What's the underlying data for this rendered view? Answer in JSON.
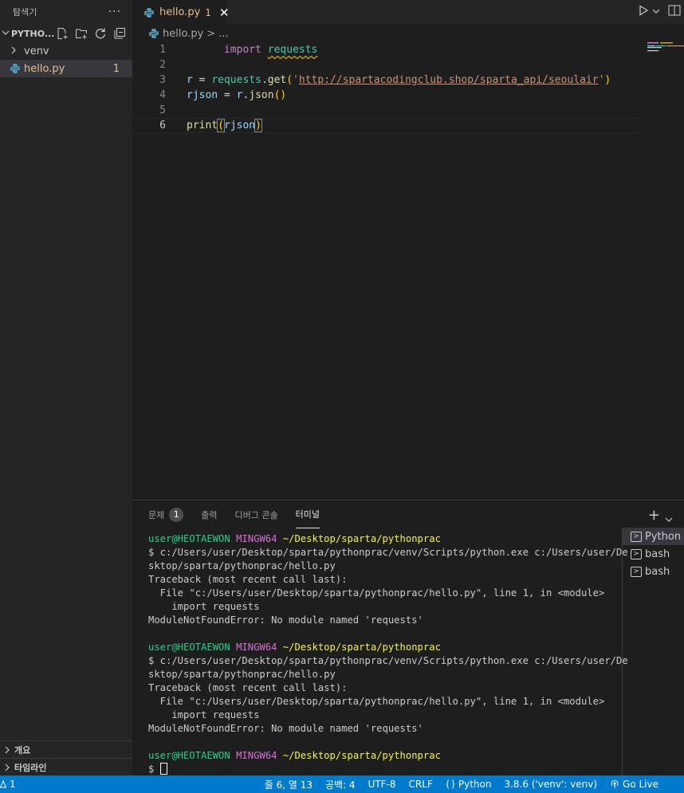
{
  "sidebar": {
    "title": "탐색기",
    "more": "···",
    "project": "PYTHO...",
    "tree": [
      {
        "label": "venv",
        "type": "folder"
      },
      {
        "label": "hello.py",
        "type": "file",
        "badge": "1"
      }
    ],
    "sections": [
      "개요",
      "타임라인"
    ]
  },
  "tab": {
    "label": "hello.py",
    "badge": "1",
    "close": "✕"
  },
  "breadcrumb": {
    "file": "hello.py",
    "sep": ">",
    "more": "..."
  },
  "editor": {
    "line_numbers": [
      "1",
      "2",
      "3",
      "4",
      "5",
      "6"
    ],
    "tokens": {
      "l1_kw": "import",
      "l1_mod": "requests",
      "l3_r": "r",
      "l3_eq": " = ",
      "l3_mod": "requests",
      "l3_dot": ".",
      "l3_fn": "get",
      "l3_open": "(",
      "l3_q1": "'",
      "l3_url": "http://spartacodingclub.shop/sparta_api/seoulair",
      "l3_q2": "'",
      "l3_close": ")",
      "l4_var": "rjson",
      "l4_eq": " = ",
      "l4_r": "r",
      "l4_dot": ".",
      "l4_fn": "json",
      "l4_parens": "()",
      "l6_fn": "print",
      "l6_open": "(",
      "l6_var": "rjson",
      "l6_close": ")"
    }
  },
  "panel": {
    "tabs": [
      {
        "label": "문제",
        "badge": "1"
      },
      {
        "label": "출력"
      },
      {
        "label": "디버그 콘솔"
      },
      {
        "label": "터미널"
      }
    ],
    "add": "+",
    "terminal_blocks": [
      {
        "user": "user@HEOTAEWON",
        "mingw": "MINGW64",
        "path": "~/Desktop/sparta/pythonprac",
        "lines": [
          "$ c:/Users/user/Desktop/sparta/pythonprac/venv/Scripts/python.exe c:/Users/user/De",
          "sktop/sparta/pythonprac/hello.py",
          "Traceback (most recent call last):",
          "  File \"c:/Users/user/Desktop/sparta/pythonprac/hello.py\", line 1, in <module>",
          "    import requests",
          "ModuleNotFoundError: No module named 'requests'"
        ]
      },
      {
        "user": "user@HEOTAEWON",
        "mingw": "MINGW64",
        "path": "~/Desktop/sparta/pythonprac",
        "lines": [
          "$ c:/Users/user/Desktop/sparta/pythonprac/venv/Scripts/python.exe c:/Users/user/De",
          "sktop/sparta/pythonprac/hello.py",
          "Traceback (most recent call last):",
          "  File \"c:/Users/user/Desktop/sparta/pythonprac/hello.py\", line 1, in <module>",
          "    import requests",
          "ModuleNotFoundError: No module named 'requests'"
        ]
      }
    ],
    "prompt_block": {
      "user": "user@HEOTAEWON",
      "mingw": "MINGW64",
      "path": "~/Desktop/sparta/pythonprac",
      "prompt": "$ "
    },
    "terminals": [
      "Python",
      "bash",
      "bash"
    ]
  },
  "statusbar": {
    "errors": "1",
    "position": "줄 6, 열 13",
    "spaces": "공백: 4",
    "encoding": "UTF-8",
    "eol": "CRLF",
    "language": "Python",
    "interpreter": "3.8.6 ('venv': venv)",
    "live": "Go Live"
  },
  "colors": {
    "statusbar": "#007acc",
    "file_modified": "#e2c08d",
    "terminal_user": "#23d18b",
    "terminal_mingw": "#d670d6",
    "terminal_path": "#f5f543"
  }
}
